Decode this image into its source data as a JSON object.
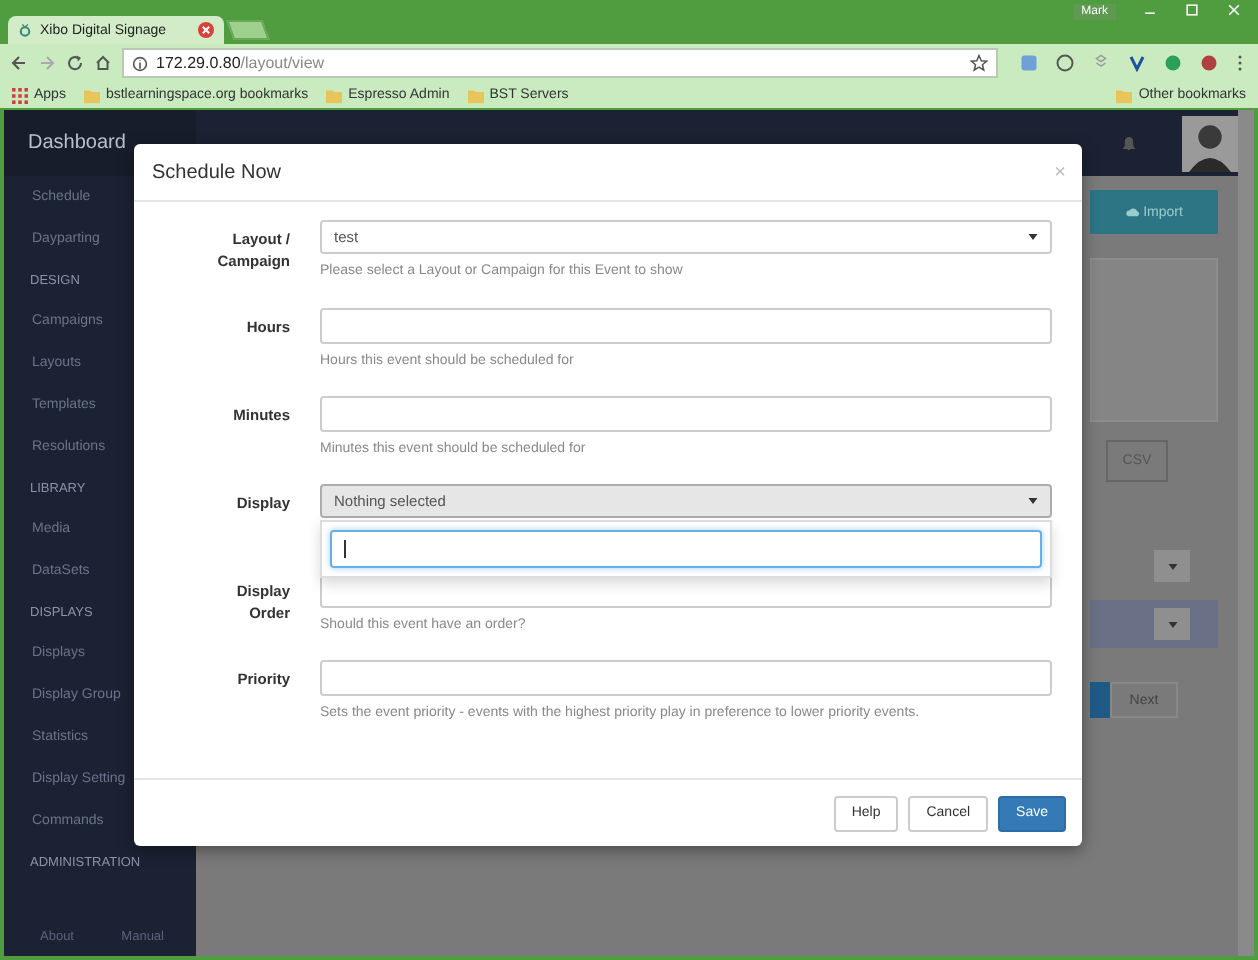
{
  "browser": {
    "user": "Mark",
    "tabs": [
      {
        "title": "Xibo Digital Signage",
        "selected": true
      }
    ],
    "address": {
      "host": "172.29.0.80",
      "path": "/layout/view"
    },
    "bookmarks": [
      {
        "kind": "apps",
        "label": "Apps"
      },
      {
        "kind": "folder",
        "label": "bstlearningspace.org bookmarks"
      },
      {
        "kind": "folder",
        "label": "Espresso Admin"
      },
      {
        "kind": "folder",
        "label": "BST Servers"
      }
    ],
    "other_bookmarks": "Other bookmarks"
  },
  "sidebar": {
    "header": "Dashboard",
    "items": [
      {
        "kind": "link",
        "label": "Schedule"
      },
      {
        "kind": "link",
        "label": "Dayparting"
      },
      {
        "kind": "section",
        "label": "DESIGN"
      },
      {
        "kind": "link",
        "label": "Campaigns"
      },
      {
        "kind": "link",
        "label": "Layouts"
      },
      {
        "kind": "link",
        "label": "Templates"
      },
      {
        "kind": "link",
        "label": "Resolutions"
      },
      {
        "kind": "section",
        "label": "LIBRARY"
      },
      {
        "kind": "link",
        "label": "Media"
      },
      {
        "kind": "link",
        "label": "DataSets"
      },
      {
        "kind": "section",
        "label": "DISPLAYS"
      },
      {
        "kind": "link",
        "label": "Displays"
      },
      {
        "kind": "link",
        "label": "Display Group"
      },
      {
        "kind": "link",
        "label": "Statistics"
      },
      {
        "kind": "link",
        "label": "Display Setting"
      },
      {
        "kind": "link",
        "label": "Commands"
      },
      {
        "kind": "section",
        "label": "ADMINISTRATION"
      }
    ],
    "footer": [
      "About",
      "Manual"
    ]
  },
  "page": {
    "import_button": "Import",
    "csv_button": "CSV",
    "next_button": "Next"
  },
  "modal": {
    "title": "Schedule Now",
    "close": "×",
    "fields": [
      {
        "kind": "select",
        "label": "Layout / Campaign",
        "value": "test",
        "help": "Please select a Layout or Campaign for this Event to show",
        "expanded": false
      },
      {
        "kind": "input",
        "label": "Hours",
        "help": "Hours this event should be scheduled for"
      },
      {
        "kind": "input",
        "label": "Minutes",
        "help": "Minutes this event should be scheduled for"
      },
      {
        "kind": "select",
        "label": "Display",
        "value": "Nothing selected",
        "expanded": true
      },
      {
        "kind": "input",
        "label": "Display Order",
        "help": "Should this event have an order?"
      },
      {
        "kind": "input",
        "label": "Priority",
        "help": "Sets the event priority - events with the highest priority play in preference to lower priority events."
      }
    ],
    "buttons": [
      {
        "kind": "default",
        "label": "Help"
      },
      {
        "kind": "default",
        "label": "Cancel"
      },
      {
        "kind": "primary",
        "label": "Save"
      }
    ]
  }
}
